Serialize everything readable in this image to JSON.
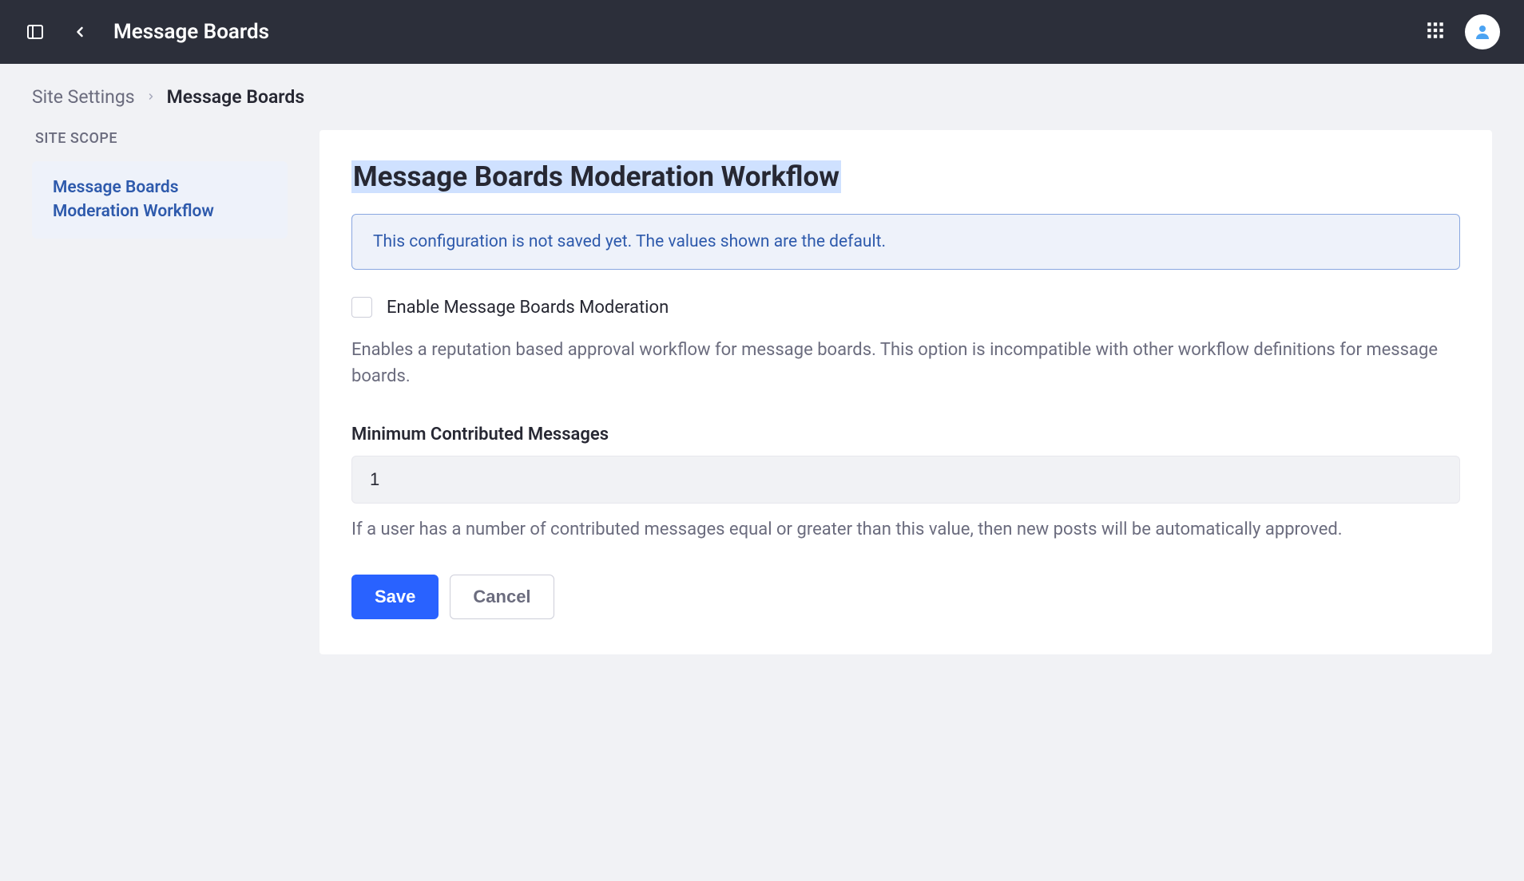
{
  "header": {
    "title": "Message Boards"
  },
  "breadcrumb": {
    "parent": "Site Settings",
    "current": "Message Boards"
  },
  "sidebar": {
    "heading": "SITE SCOPE",
    "items": [
      {
        "label": "Message Boards Moderation Workflow"
      }
    ]
  },
  "panel": {
    "title": "Message Boards Moderation Workflow",
    "info_banner": "This configuration is not saved yet. The values shown are the default.",
    "enable_checkbox_label": "Enable Message Boards Moderation",
    "enable_help": "Enables a reputation based approval workflow for message boards. This option is incompatible with other workflow definitions for message boards.",
    "min_messages_label": "Minimum Contributed Messages",
    "min_messages_value": "1",
    "min_messages_help": "If a user has a number of contributed messages equal or greater than this value, then new posts will be automatically approved.",
    "save_label": "Save",
    "cancel_label": "Cancel"
  }
}
